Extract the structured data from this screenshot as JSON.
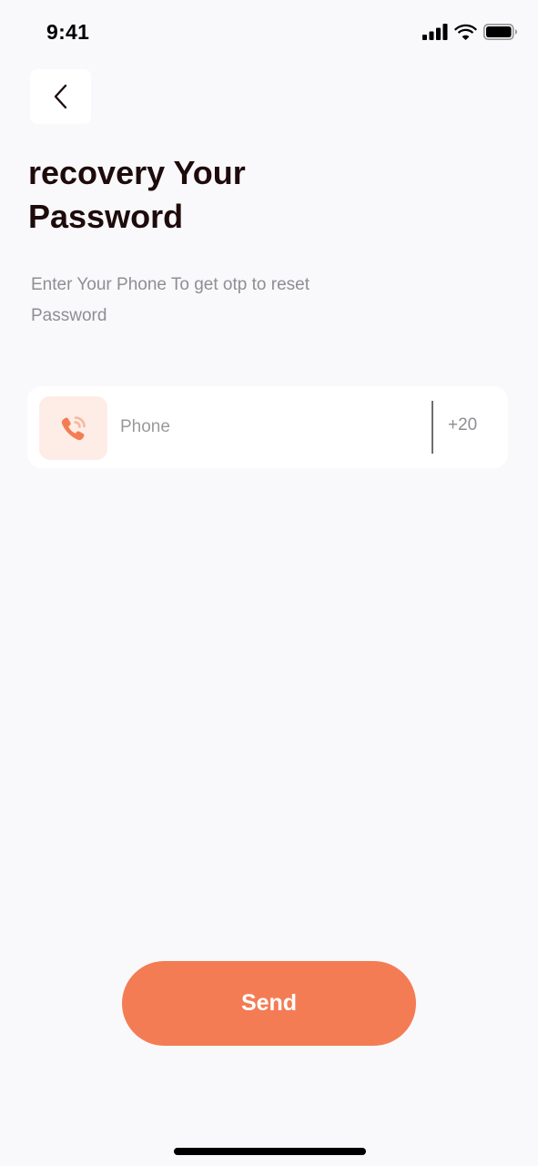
{
  "status_bar": {
    "time": "9:41",
    "icons": [
      "cellular-signal-icon",
      "wifi-icon",
      "battery-icon"
    ]
  },
  "header": {
    "back_icon": "chevron-left-icon",
    "title_line1": "recovery Your",
    "title_line2": "Password",
    "subtitle_line1": "Enter Your Phone To get otp to reset",
    "subtitle_line2": "Password"
  },
  "phone_field": {
    "icon": "phone-icon",
    "placeholder": "Phone",
    "value": "",
    "country_code": "+20"
  },
  "send_button": {
    "label": "Send"
  },
  "colors": {
    "background": "#F9F9FB",
    "accent": "#F47C55",
    "accent_light": "#FDEDE6",
    "title": "#1E0B0B",
    "muted_text": "#8E8E93"
  }
}
